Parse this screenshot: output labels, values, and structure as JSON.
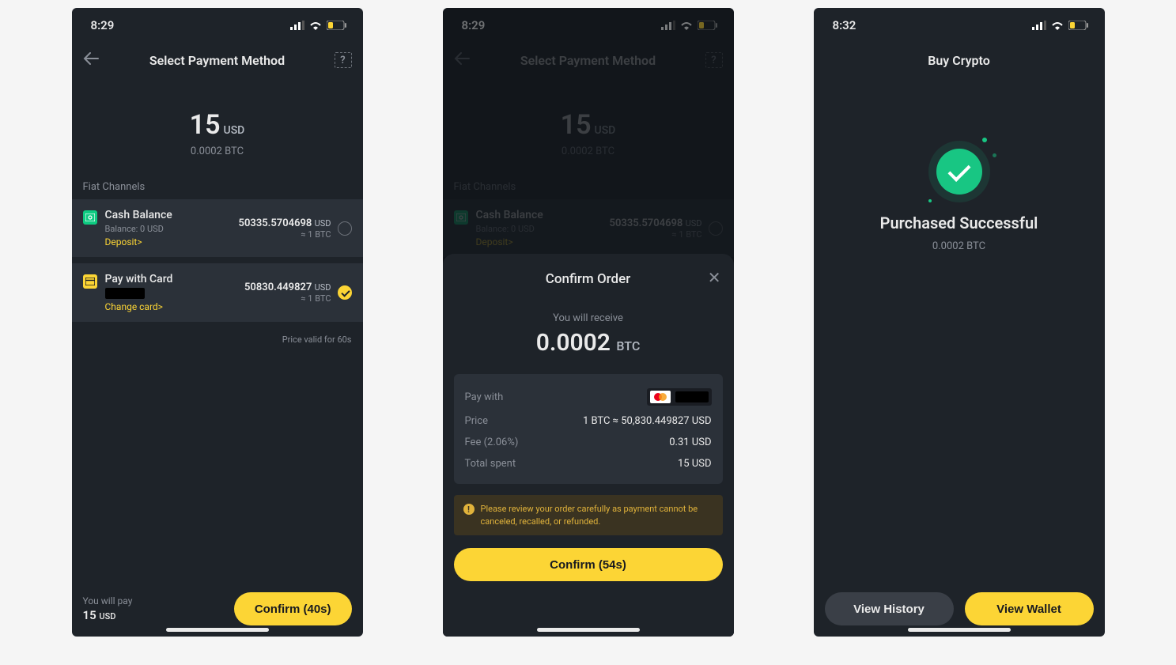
{
  "screen1": {
    "status_time": "8:29",
    "header": {
      "title": "Select Payment Method"
    },
    "amount": {
      "value": "15",
      "currency": "USD",
      "crypto_equiv": "0.0002 BTC"
    },
    "section_label": "Fiat Channels",
    "cash": {
      "title": "Cash Balance",
      "balance_label": "Balance:  0 USD",
      "deposit_link": "Deposit>",
      "rate": "50335.5704698",
      "rate_currency": "USD",
      "approx": "≈ 1 BTC"
    },
    "card": {
      "title": "Pay with Card",
      "change_link": "Change card>",
      "rate": "50830.449827",
      "rate_currency": "USD",
      "approx": "≈ 1  BTC"
    },
    "price_valid": "Price valid for 60s",
    "footer": {
      "label": "You will pay",
      "amount": "15",
      "currency": "USD",
      "confirm_label": "Confirm (40s)"
    }
  },
  "screen2": {
    "status_time": "8:29",
    "header": {
      "title": "Select Payment Method"
    },
    "amount": {
      "value": "15",
      "currency": "USD",
      "crypto_equiv": "0.0002 BTC"
    },
    "section_label": "Fiat Channels",
    "cash": {
      "title": "Cash Balance",
      "balance_label": "Balance:  0 USD",
      "deposit_link": "Deposit>",
      "rate": "50335.5704698",
      "rate_currency": "USD",
      "approx": "≈ 1 BTC"
    },
    "sheet": {
      "title": "Confirm Order",
      "receive_label": "You will receive",
      "receive_value": "0.0002",
      "receive_currency": "BTC",
      "row_pay_with": "Pay with",
      "row_price_k": "Price",
      "row_price_v": "1 BTC ≈ 50,830.449827 USD",
      "row_fee_k": "Fee (2.06%)",
      "row_fee_v": "0.31 USD",
      "row_total_k": "Total spent",
      "row_total_v": "15 USD",
      "warning": "Please review your order carefully as payment cannot be canceled, recalled, or refunded.",
      "confirm_label": "Confirm (54s)"
    }
  },
  "screen3": {
    "status_time": "8:32",
    "header": {
      "title": "Buy Crypto"
    },
    "success_title": "Purchased Successful",
    "success_sub": "0.0002 BTC",
    "btn_history": "View History",
    "btn_wallet": "View Wallet"
  }
}
